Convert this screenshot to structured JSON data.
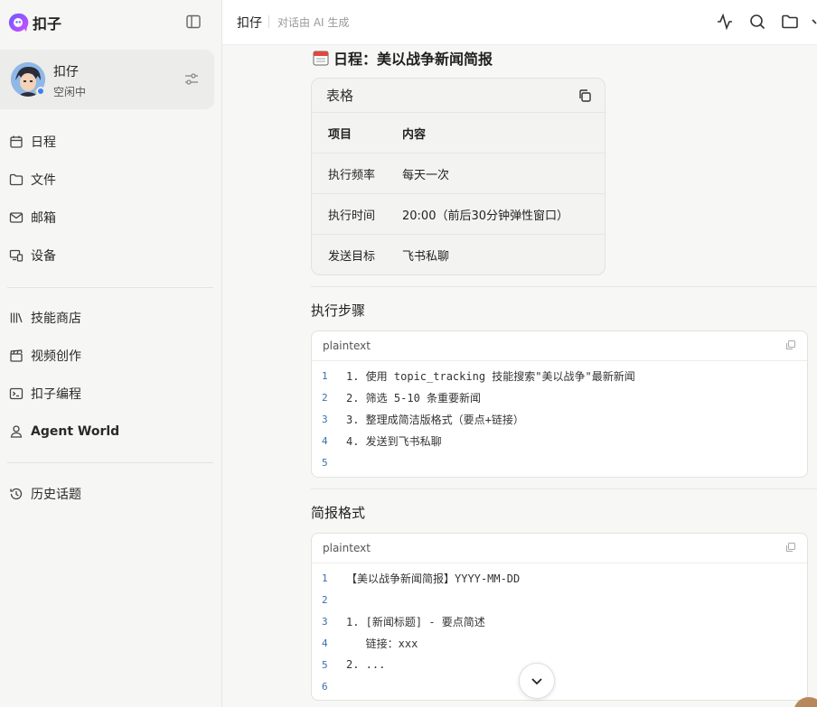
{
  "app": {
    "name": "扣子"
  },
  "profile": {
    "name": "扣仔",
    "status": "空闲中"
  },
  "nav": {
    "items": [
      {
        "label": "日程",
        "icon": "calendar-icon"
      },
      {
        "label": "文件",
        "icon": "folder-icon"
      },
      {
        "label": "邮箱",
        "icon": "mail-icon"
      },
      {
        "label": "设备",
        "icon": "device-icon"
      }
    ],
    "items2": [
      {
        "label": "技能商店",
        "icon": "library-icon"
      },
      {
        "label": "视频创作",
        "icon": "clapperboard-icon"
      },
      {
        "label": "扣子编程",
        "icon": "terminal-icon"
      },
      {
        "label": "Agent World",
        "icon": "person-icon"
      }
    ],
    "history": {
      "label": "历史话题",
      "icon": "history-icon"
    }
  },
  "topbar": {
    "title": "扣仔",
    "subtitle": "对话由 AI 生成"
  },
  "doc": {
    "title": "日程：美以战争新闻简报",
    "table": {
      "label": "表格",
      "headers": [
        "项目",
        "内容"
      ],
      "rows": [
        [
          "执行频率",
          "每天一次"
        ],
        [
          "执行时间",
          "20:00（前后30分钟弹性窗口）"
        ],
        [
          "发送目标",
          "飞书私聊"
        ]
      ]
    },
    "steps": {
      "heading": "执行步骤",
      "lang": "plaintext",
      "lines": [
        "1. 使用 topic_tracking 技能搜索\"美以战争\"最新新闻",
        "2. 筛选 5-10 条重要新闻",
        "3. 整理成简洁版格式（要点+链接）",
        "4. 发送到飞书私聊",
        ""
      ]
    },
    "format": {
      "heading": "简报格式",
      "lang": "plaintext",
      "lines": [
        "【美以战争新闻简报】YYYY-MM-DD",
        "",
        "1. [新闻标题] - 要点简述",
        "   链接：xxx",
        "2. ...",
        ""
      ]
    }
  },
  "colors": {
    "accent": "#3d7df5",
    "line_number": "#3a6fa8",
    "sidebar_bg": "#f6f6f4"
  }
}
